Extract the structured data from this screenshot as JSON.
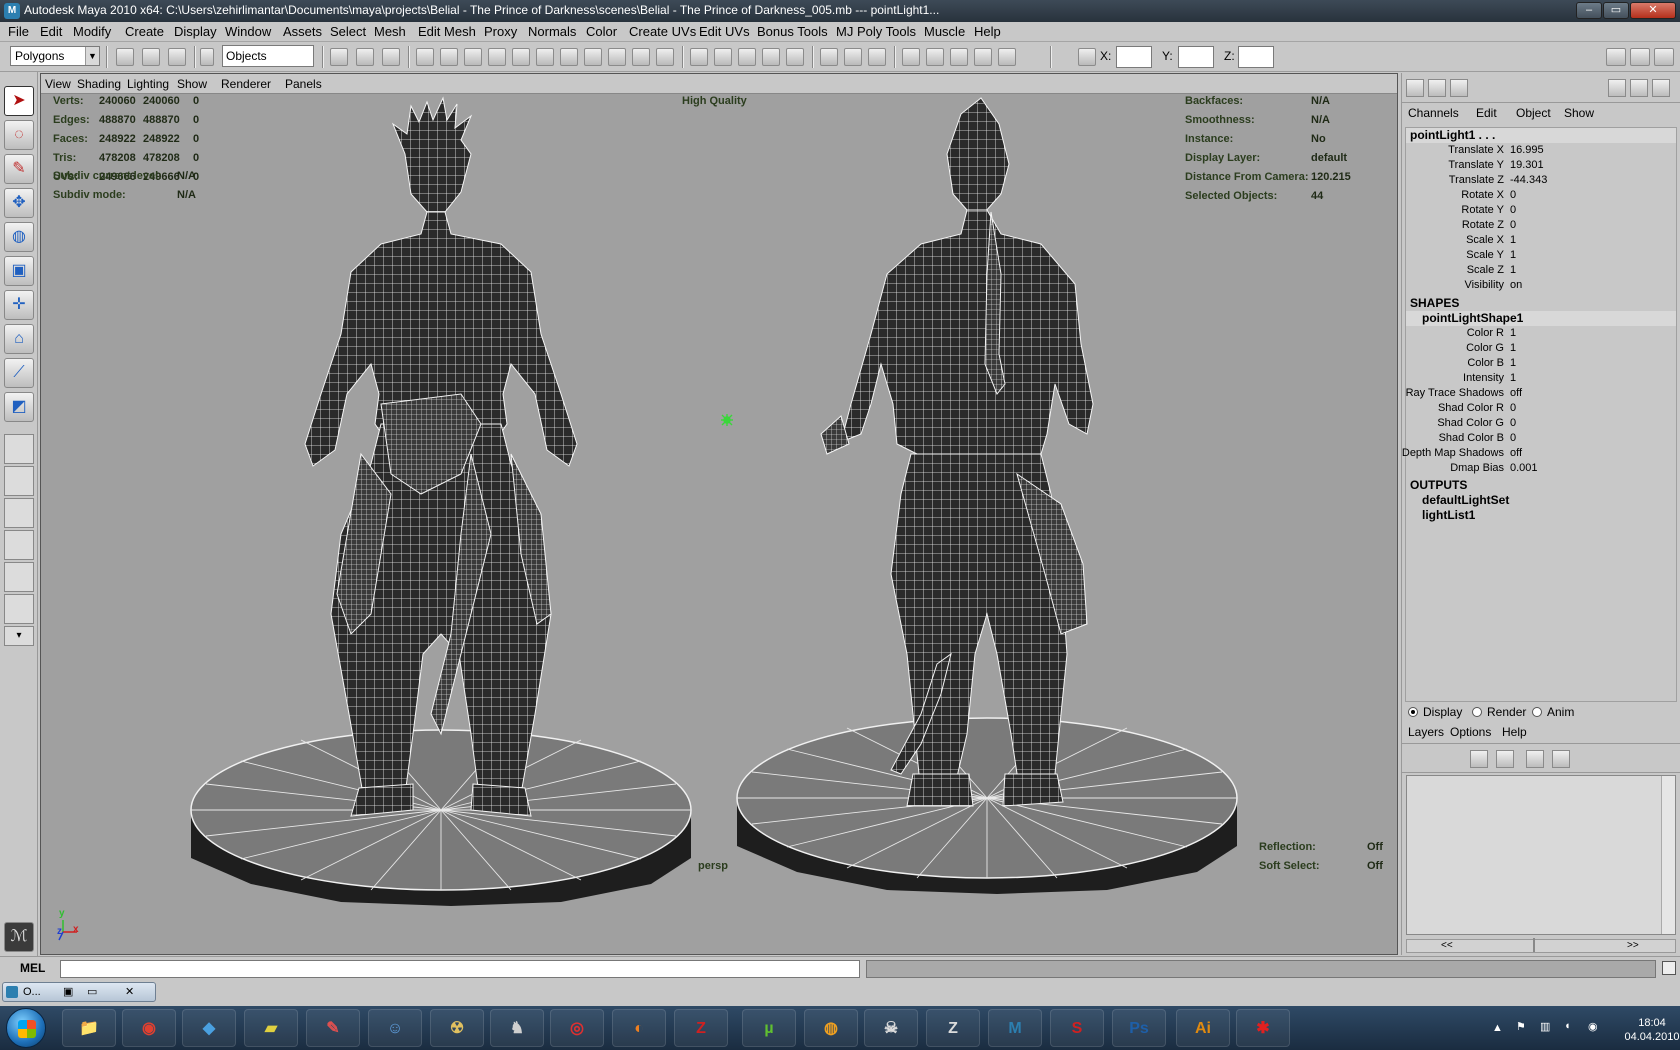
{
  "window": {
    "title": "Autodesk Maya 2010 x64: C:\\Users\\zehirlimantar\\Documents\\maya\\projects\\Belial - The Prince of Darkness\\scenes\\Belial - The Prince of Darkness_005.mb   ---   pointLight1...",
    "minimize": "–",
    "maximize": "▭",
    "close": "✕"
  },
  "menu": [
    "File",
    "Edit",
    "Modify",
    "Create",
    "Display",
    "Window",
    "Assets",
    "Select",
    "Mesh",
    "Edit Mesh",
    "Proxy",
    "Normals",
    "Color",
    "Create UVs",
    "Edit UVs",
    "Bonus Tools",
    "MJ Poly Tools",
    "Muscle",
    "Help"
  ],
  "statusline": {
    "mode": "Polygons",
    "selection_mode": "Objects",
    "x_label": "X:",
    "y_label": "Y:",
    "z_label": "Z:"
  },
  "viewport": {
    "panel_menu": [
      "View",
      "Shading",
      "Lighting",
      "Show",
      "Renderer",
      "Panels"
    ],
    "quality": "High Quality",
    "camera": "persp",
    "poly_count": [
      {
        "label": "Verts:",
        "a": "240060",
        "b": "240060",
        "c": "0"
      },
      {
        "label": "Edges:",
        "a": "488870",
        "b": "488870",
        "c": "0"
      },
      {
        "label": "Faces:",
        "a": "248922",
        "b": "248922",
        "c": "0"
      },
      {
        "label": "Tris:",
        "a": "478208",
        "b": "478208",
        "c": "0"
      },
      {
        "label": "UVs:",
        "a": "249666",
        "b": "249666",
        "c": "0"
      }
    ],
    "subdiv": [
      {
        "label": "Subdiv current level:",
        "value": "N/A"
      },
      {
        "label": "Subdiv mode:",
        "value": "N/A"
      }
    ],
    "info": [
      {
        "label": "Backfaces:",
        "value": "N/A"
      },
      {
        "label": "Smoothness:",
        "value": "N/A"
      },
      {
        "label": "Instance:",
        "value": "No"
      },
      {
        "label": "Display Layer:",
        "value": "default"
      },
      {
        "label": "Distance From Camera:",
        "value": "120.215"
      },
      {
        "label": "Selected Objects:",
        "value": "44"
      }
    ],
    "bottom_info": [
      {
        "label": "Reflection:",
        "value": "Off"
      },
      {
        "label": "Soft Select:",
        "value": "Off"
      }
    ],
    "axis": {
      "y": "y",
      "z": "z",
      "x": "x"
    },
    "colors": {
      "background": "#a0a0a0",
      "wire": "#ffffff",
      "surface": "#2b2b2b",
      "hud": "#213a15"
    }
  },
  "channelbox": {
    "menu": [
      "Channels",
      "Edit",
      "Object",
      "Show"
    ],
    "node": "pointLight1 . . .",
    "attributes": [
      {
        "name": "Translate X",
        "value": "16.995"
      },
      {
        "name": "Translate Y",
        "value": "19.301"
      },
      {
        "name": "Translate Z",
        "value": "-44.343"
      },
      {
        "name": "Rotate X",
        "value": "0"
      },
      {
        "name": "Rotate Y",
        "value": "0"
      },
      {
        "name": "Rotate Z",
        "value": "0"
      },
      {
        "name": "Scale X",
        "value": "1"
      },
      {
        "name": "Scale Y",
        "value": "1"
      },
      {
        "name": "Scale Z",
        "value": "1"
      },
      {
        "name": "Visibility",
        "value": "on"
      }
    ],
    "shapes_label": "SHAPES",
    "shape_node": "pointLightShape1",
    "shape_attributes": [
      {
        "name": "Color R",
        "value": "1"
      },
      {
        "name": "Color G",
        "value": "1"
      },
      {
        "name": "Color B",
        "value": "1"
      },
      {
        "name": "Intensity",
        "value": "1"
      },
      {
        "name": "Ray Trace Shadows",
        "value": "off"
      },
      {
        "name": "Shad Color R",
        "value": "0"
      },
      {
        "name": "Shad Color G",
        "value": "0"
      },
      {
        "name": "Shad Color B",
        "value": "0"
      },
      {
        "name": "Depth Map Shadows",
        "value": "off"
      },
      {
        "name": "Dmap Bias",
        "value": "0.001"
      }
    ],
    "outputs_label": "OUTPUTS",
    "outputs": [
      "defaultLightSet",
      "lightList1"
    ]
  },
  "layers": {
    "radio": [
      "Display",
      "Render",
      "Anim"
    ],
    "selected_radio": "Display",
    "menu": [
      "Layers",
      "Options",
      "Help"
    ],
    "nav_left": "<<",
    "nav_right": ">>"
  },
  "cmdline": {
    "label": "MEL",
    "minimized_window": "O..."
  },
  "taskbar": {
    "apps": [
      {
        "name": "explorer",
        "glyph": "📁",
        "color": "#f0c040"
      },
      {
        "name": "chrome",
        "glyph": "◉",
        "color": "#e04030"
      },
      {
        "name": "app3",
        "glyph": "◆",
        "color": "#4aa0e0"
      },
      {
        "name": "app4",
        "glyph": "▰",
        "color": "#e0d040"
      },
      {
        "name": "app5",
        "glyph": "✎",
        "color": "#e05050"
      },
      {
        "name": "app6",
        "glyph": "☺",
        "color": "#60a0e0"
      },
      {
        "name": "app7",
        "glyph": "☢",
        "color": "#e0c060"
      },
      {
        "name": "app8",
        "glyph": "♞",
        "color": "#cfcfcf"
      },
      {
        "name": "app9",
        "glyph": "◎",
        "color": "#e03030"
      },
      {
        "name": "firefox",
        "glyph": "◐",
        "color": "#f08020"
      },
      {
        "name": "filezilla",
        "glyph": "Z",
        "color": "#d02020"
      },
      {
        "name": "utorrent",
        "glyph": "µ",
        "color": "#60c030"
      },
      {
        "name": "app13",
        "glyph": "◍",
        "color": "#f0a020"
      },
      {
        "name": "app14",
        "glyph": "☠",
        "color": "#dcdcdc"
      },
      {
        "name": "zbrush",
        "glyph": "Z",
        "color": "#dcdcdc"
      },
      {
        "name": "maya",
        "glyph": "M",
        "color": "#2c7fb0"
      },
      {
        "name": "sbp",
        "glyph": "S",
        "color": "#d02020"
      },
      {
        "name": "photoshop",
        "glyph": "Ps",
        "color": "#1e5fa8"
      },
      {
        "name": "illustrator",
        "glyph": "Ai",
        "color": "#e08a10"
      },
      {
        "name": "app20",
        "glyph": "✱",
        "color": "#e02020"
      }
    ],
    "time": "18:04",
    "date": "04.04.2010"
  }
}
